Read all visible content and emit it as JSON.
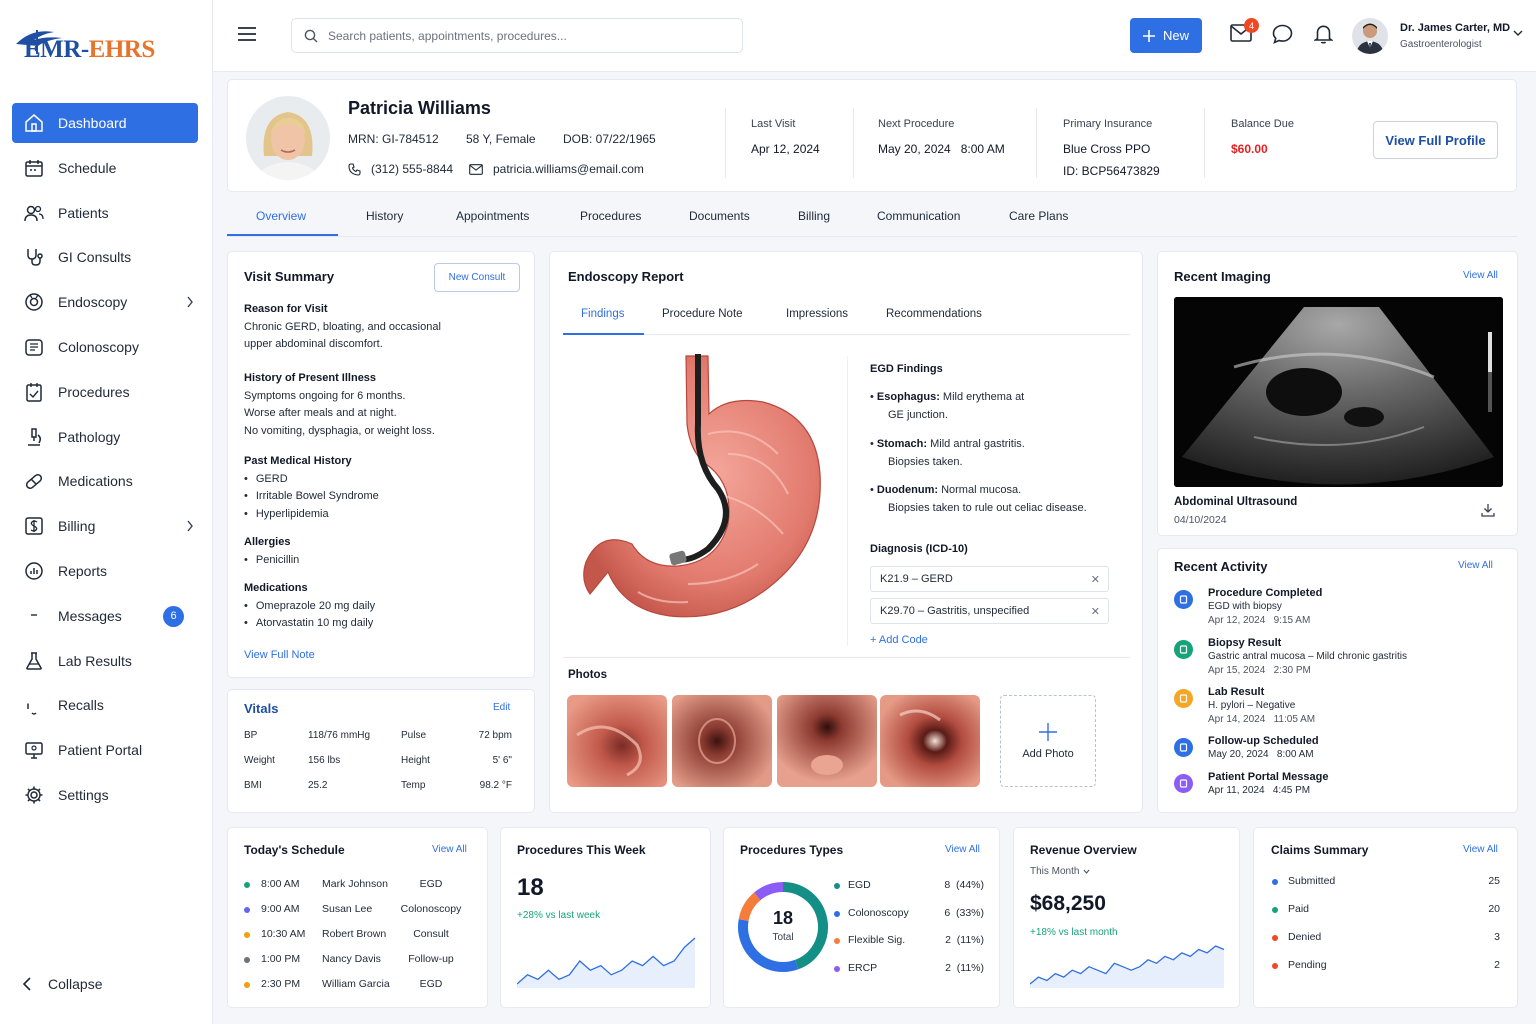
{
  "app": {
    "logo": {
      "part1": "EMR-",
      "part2": "EHRS"
    },
    "nav": [
      {
        "label": "Dashboard",
        "icon": "home-icon",
        "active": true
      },
      {
        "label": "Schedule",
        "icon": "calendar-icon"
      },
      {
        "label": "Patients",
        "icon": "users-icon"
      },
      {
        "label": "GI Consults",
        "icon": "stethoscope-icon"
      },
      {
        "label": "Endoscopy",
        "icon": "camera-icon",
        "chevron": true
      },
      {
        "label": "Colonoscopy",
        "icon": "colon-icon"
      },
      {
        "label": "Procedures",
        "icon": "clipboard-calendar-icon"
      },
      {
        "label": "Pathology",
        "icon": "microscope-icon"
      },
      {
        "label": "Medications",
        "icon": "pill-icon"
      },
      {
        "label": "Billing",
        "icon": "dollar-icon",
        "chevron": true
      },
      {
        "label": "Reports",
        "icon": "chart-icon"
      },
      {
        "label": "Messages",
        "icon": "message-icon",
        "badge": "6"
      },
      {
        "label": "Lab Results",
        "icon": "flask-icon"
      },
      {
        "label": "Recalls",
        "icon": "bell-icon"
      },
      {
        "label": "Patient Portal",
        "icon": "monitor-icon"
      },
      {
        "label": "Settings",
        "icon": "gear-icon"
      }
    ],
    "collapse_label": "Collapse"
  },
  "topbar": {
    "search_placeholder": "Search patients, appointments, procedures...",
    "new_label": "New",
    "mail_badge": "4",
    "user_name": "Dr. James Carter, MD",
    "user_role": "Gastroenterologist"
  },
  "patient": {
    "name": "Patricia Williams",
    "mrn": "MRN: GI-784512",
    "age_sex": "58 Y, Female",
    "dob": "DOB: 07/22/1965",
    "phone": "(312) 555-8844",
    "email": "patricia.williams@email.com",
    "last_visit_label": "Last Visit",
    "last_visit": "Apr 12, 2024",
    "next_proc_label": "Next Procedure",
    "next_proc": "May 20, 2024   8:00 AM",
    "insurance_label": "Primary Insurance",
    "insurance": "Blue Cross PPO",
    "insurance_id": "ID: BCP56473829",
    "balance_label": "Balance Due",
    "balance": "$60.00",
    "view_profile": "View Full Profile"
  },
  "tabs": [
    "Overview",
    "History",
    "Appointments",
    "Procedures",
    "Documents",
    "Billing",
    "Communication",
    "Care Plans"
  ],
  "visit_summary": {
    "title": "Visit Summary",
    "new_consult": "New Consult",
    "reason_h": "Reason for Visit",
    "reason_1": "Chronic GERD, bloating, and occasional",
    "reason_2": "upper abdominal discomfort.",
    "hpi_h": "History of Present Illness",
    "hpi_1": "Symptoms ongoing for 6 months.",
    "hpi_2": "Worse after meals and at night.",
    "hpi_3": "No vomiting, dysphagia, or weight loss.",
    "pmh_h": "Past Medical History",
    "pmh": [
      "GERD",
      "Irritable Bowel Syndrome",
      "Hyperlipidemia"
    ],
    "allergies_h": "Allergies",
    "allergies": [
      "Penicillin"
    ],
    "meds_h": "Medications",
    "meds": [
      "Omeprazole 20 mg daily",
      "Atorvastatin 10 mg daily"
    ],
    "view_note": "View Full Note"
  },
  "vitals": {
    "title": "Vitals",
    "edit": "Edit",
    "rows": [
      {
        "l1": "BP",
        "v1": "118/76 mmHg",
        "l2": "Pulse",
        "v2": "72 bpm"
      },
      {
        "l1": "Weight",
        "v1": "156 lbs",
        "l2": "Height",
        "v2": "5' 6\""
      },
      {
        "l1": "BMI",
        "v1": "25.2",
        "l2": "Temp",
        "v2": "98.2 °F"
      }
    ]
  },
  "endoscopy": {
    "title": "Endoscopy Report",
    "tabs": [
      "Findings",
      "Procedure Note",
      "Impressions",
      "Recommendations"
    ],
    "findings_h": "EGD Findings",
    "f1_b": "Esophagus:",
    "f1_t": " Mild erythema at",
    "f1_t2": "GE junction.",
    "f2_b": "Stomach:",
    "f2_t": " Mild antral gastritis.",
    "f2_t2": "Biopsies taken.",
    "f3_b": "Duodenum:",
    "f3_t": " Normal mucosa.",
    "f3_t2": "Biopsies taken to rule out celiac disease.",
    "dx_h": "Diagnosis (ICD-10)",
    "dx": [
      "K21.9 – GERD",
      "K29.70 – Gastritis, unspecified"
    ],
    "add_code": "+ Add Code",
    "photos_h": "Photos",
    "add_photo": "Add Photo"
  },
  "imaging": {
    "title": "Recent Imaging",
    "view_all": "View All",
    "name": "Abdominal Ultrasound",
    "date": "04/10/2024"
  },
  "activity": {
    "title": "Recent Activity",
    "view_all": "View All",
    "items": [
      {
        "title": "Procedure Completed",
        "desc": "EGD with biopsy",
        "time": "Apr 12, 2024   9:15 AM",
        "color": "#2f6fe4"
      },
      {
        "title": "Biopsy Result",
        "desc": "Gastric antral mucosa – Mild chronic gastritis",
        "time": "Apr 15, 2024   2:30 PM",
        "color": "#17a37a"
      },
      {
        "title": "Lab Result",
        "desc": "H. pylori – Negative",
        "time": "Apr 14, 2024   11:05 AM",
        "color": "#f5a623"
      },
      {
        "title": "Follow-up Scheduled",
        "desc": "May 20, 2024   8:00 AM",
        "time": "",
        "color": "#2f6fe4"
      },
      {
        "title": "Patient Portal Message",
        "desc": "Apr 11, 2024   4:45 PM",
        "time": "",
        "color": "#8b5cf6"
      }
    ]
  },
  "schedule": {
    "title": "Today's Schedule",
    "view_all": "View All",
    "rows": [
      {
        "time": "8:00 AM",
        "name": "Mark Johnson",
        "type": "EGD",
        "color": "#17a37a"
      },
      {
        "time": "9:00 AM",
        "name": "Susan Lee",
        "type": "Colonoscopy",
        "color": "#6366f1"
      },
      {
        "time": "10:30 AM",
        "name": "Robert Brown",
        "type": "Consult",
        "color": "#f59e0b"
      },
      {
        "time": "1:00 PM",
        "name": "Nancy Davis",
        "type": "Follow-up",
        "color": "#6b7280"
      },
      {
        "time": "2:30 PM",
        "name": "William Garcia",
        "type": "EGD",
        "color": "#f59e0b"
      }
    ]
  },
  "proc_week": {
    "title": "Procedures This Week",
    "value": "18",
    "change": "+28% vs last week",
    "spark": [
      4,
      6,
      5,
      7,
      5,
      6,
      9,
      7,
      8,
      6,
      7,
      9,
      8,
      10,
      8,
      9,
      12,
      14
    ]
  },
  "proc_types": {
    "title": "Procedures Types",
    "view_all": "View All",
    "total": "18",
    "total_label": "Total",
    "items": [
      {
        "name": "EGD",
        "value": 8,
        "label": "8  (44%)",
        "color": "#138f86"
      },
      {
        "name": "Colonoscopy",
        "value": 6,
        "label": "6  (33%)",
        "color": "#2f6fe4"
      },
      {
        "name": "Flexible Sig.",
        "value": 2,
        "label": "2  (11%)",
        "color": "#f57c3a"
      },
      {
        "name": "ERCP",
        "value": 2,
        "label": "2  (11%)",
        "color": "#8b5cf6"
      }
    ]
  },
  "revenue": {
    "title": "Revenue Overview",
    "period": "This Month",
    "value": "$68,250",
    "change": "+18% vs last month",
    "spark": [
      3,
      5,
      4,
      6,
      5,
      7,
      6,
      8,
      7,
      6,
      9,
      8,
      7,
      8,
      10,
      9,
      11,
      10,
      12,
      11,
      13,
      12,
      14,
      13
    ]
  },
  "claims": {
    "title": "Claims Summary",
    "view_all": "View All",
    "items": [
      {
        "name": "Submitted",
        "value": "25",
        "color": "#2f6fe4"
      },
      {
        "name": "Paid",
        "value": "20",
        "color": "#17a37a"
      },
      {
        "name": "Denied",
        "value": "3",
        "color": "#ef4823"
      },
      {
        "name": "Pending",
        "value": "2",
        "color": "#ef4823"
      }
    ]
  }
}
